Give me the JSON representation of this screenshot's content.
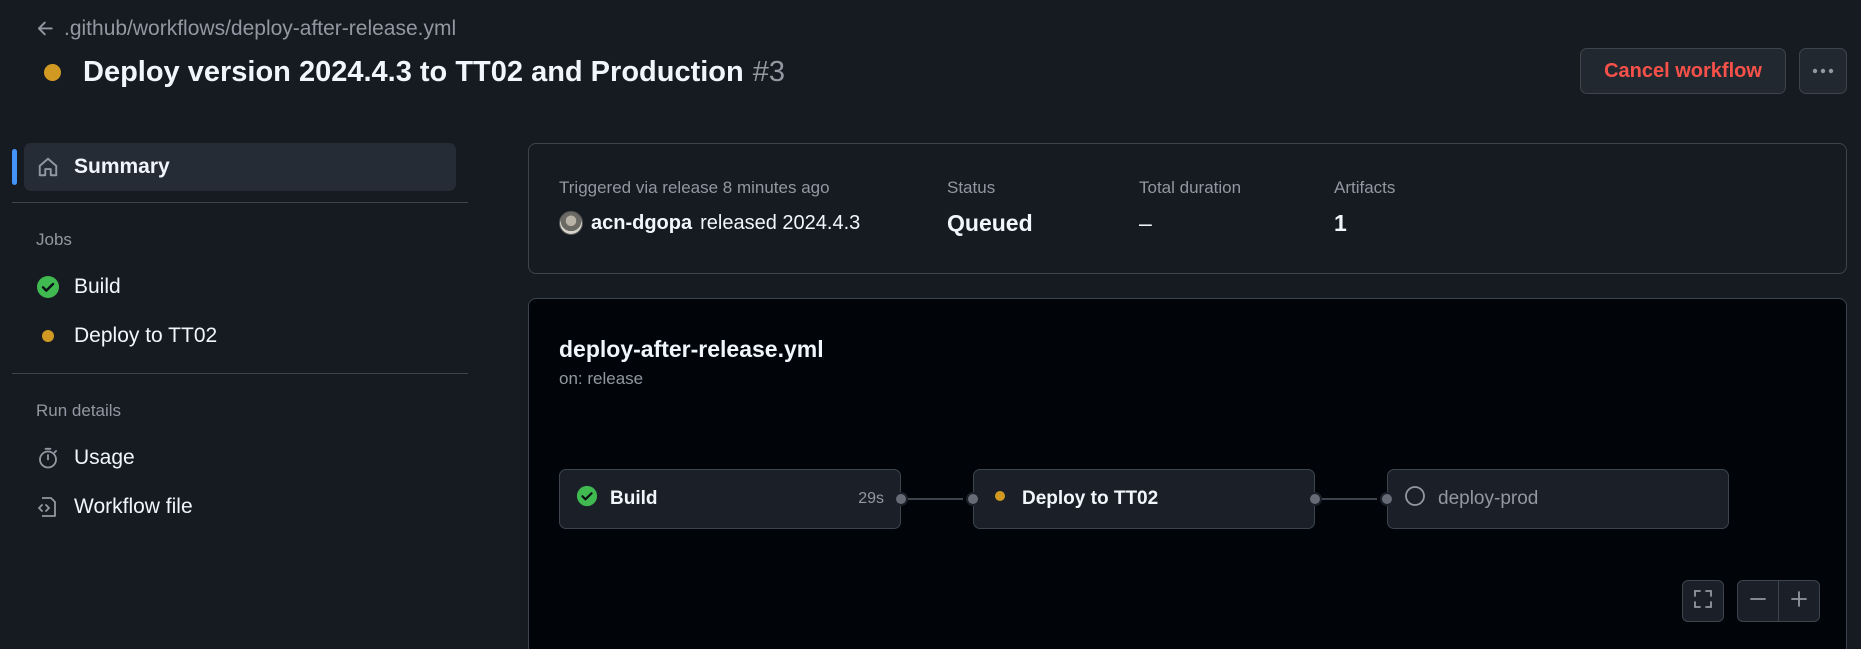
{
  "breadcrumb": {
    "path": ".github/workflows/deploy-after-release.yml"
  },
  "header": {
    "title": "Deploy version 2024.4.3 to TT02 and Production",
    "run_number": "#3",
    "cancel_label": "Cancel workflow",
    "status_color": "#d29922"
  },
  "sidebar": {
    "summary_label": "Summary",
    "jobs_heading": "Jobs",
    "jobs": [
      {
        "label": "Build",
        "status": "success"
      },
      {
        "label": "Deploy to TT02",
        "status": "queued"
      }
    ],
    "run_details_heading": "Run details",
    "run_details": [
      {
        "label": "Usage",
        "icon": "stopwatch-icon"
      },
      {
        "label": "Workflow file",
        "icon": "file-code-icon"
      }
    ]
  },
  "summary": {
    "trigger_label": "Triggered via release 8 minutes ago",
    "actor": "acn-dgopa",
    "action_text": "released 2024.4.3",
    "status_label": "Status",
    "status_value": "Queued",
    "duration_label": "Total duration",
    "duration_value": "–",
    "artifacts_label": "Artifacts",
    "artifacts_value": "1"
  },
  "graph": {
    "workflow_file": "deploy-after-release.yml",
    "trigger": "on: release",
    "jobs": [
      {
        "name": "Build",
        "duration": "29s",
        "status": "success"
      },
      {
        "name": "Deploy to TT02",
        "duration": "",
        "status": "queued"
      },
      {
        "name": "deploy-prod",
        "duration": "",
        "status": "pending"
      }
    ]
  },
  "colors": {
    "success": "#3fb950",
    "queued": "#d29922",
    "danger": "#f85149",
    "accent": "#4493f8"
  }
}
